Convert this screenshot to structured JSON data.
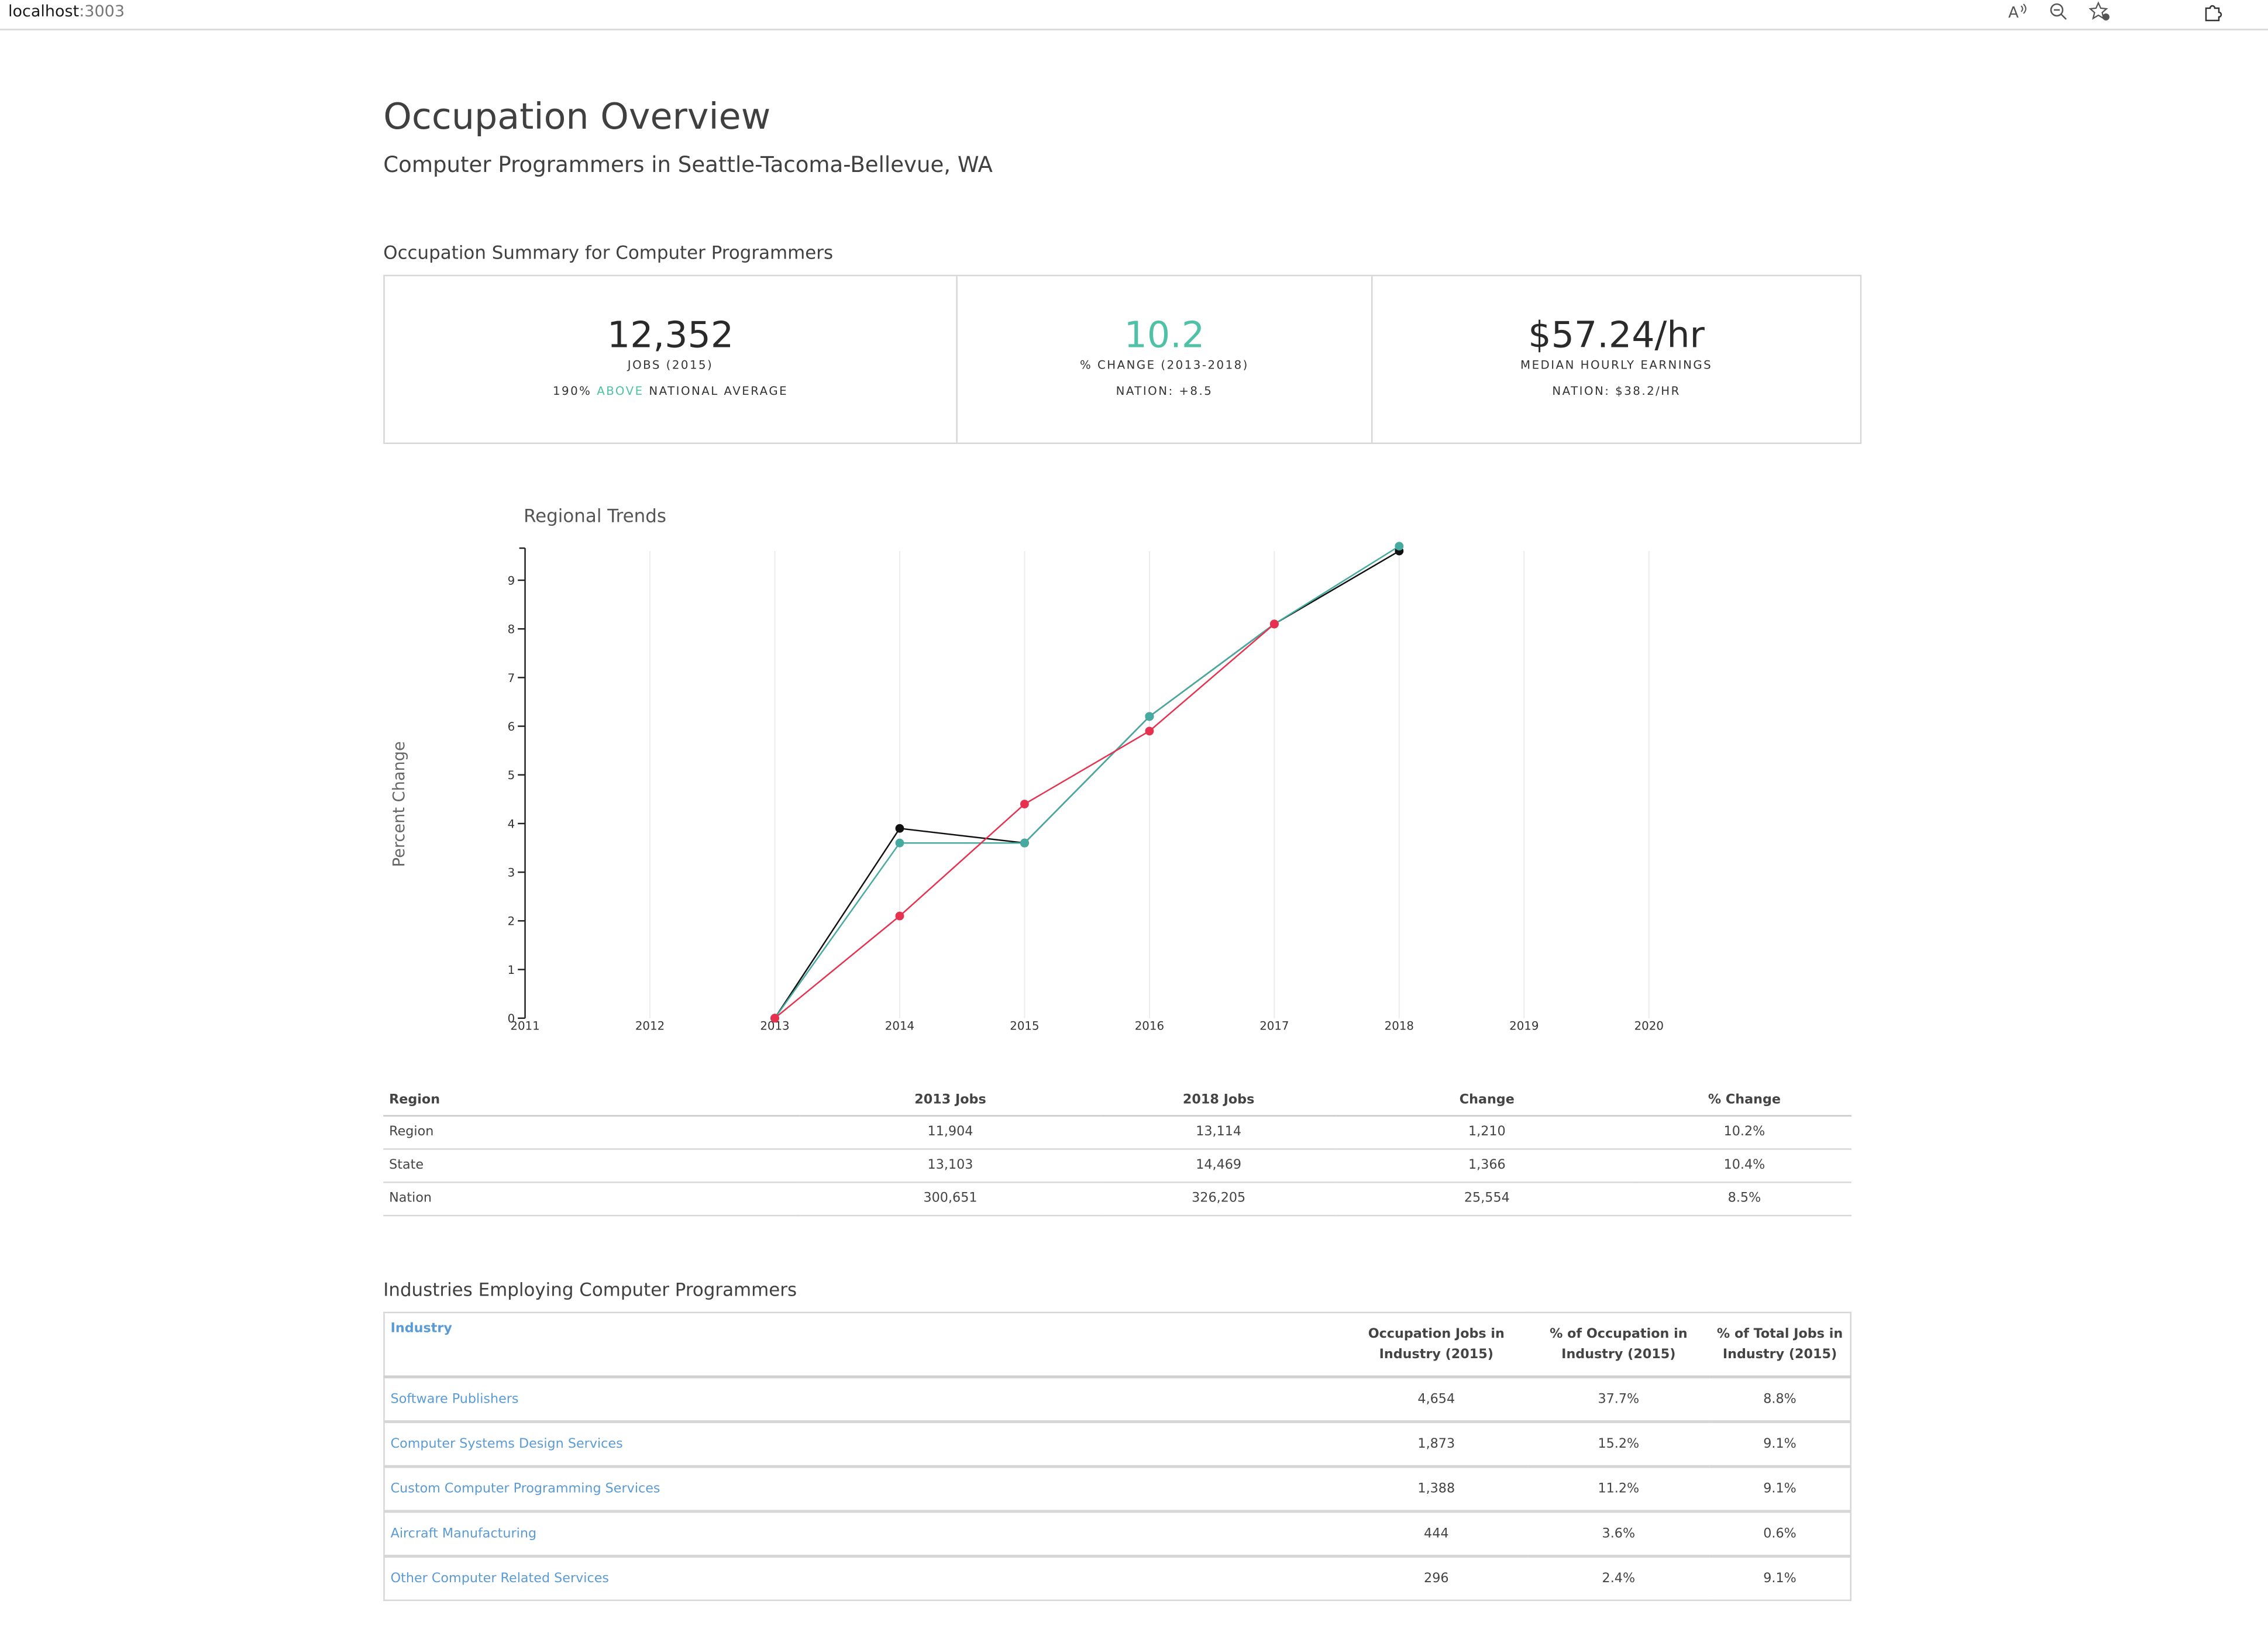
{
  "browser": {
    "address_host": "localhost",
    "address_port": ":3003",
    "icons": [
      "read-aloud-icon",
      "zoom-out-icon",
      "add-favorite-icon",
      "extensions-icon"
    ]
  },
  "page": {
    "title": "Occupation Overview",
    "subtitle": "Computer Programmers in Seattle-Tacoma-Bellevue, WA"
  },
  "summary": {
    "section_title": "Occupation Summary for Computer Programmers",
    "jobs": {
      "value": "12,352",
      "label": "JOBS (2015)",
      "sub_prefix": "190% ",
      "sub_highlight": "ABOVE",
      "sub_suffix": " NATIONAL AVERAGE"
    },
    "change": {
      "value": "10.2",
      "label": "% CHANGE (2013-2018)",
      "sub": "NATION: +8.5"
    },
    "earnings": {
      "value": "$57.24/hr",
      "label": "MEDIAN HOURLY EARNINGS",
      "sub": "NATION: $38.2/HR"
    }
  },
  "colors": {
    "accent": "#4fc1a6",
    "link": "#5b9bd5",
    "nation_line": "#e8304f",
    "region_line": "#111111",
    "state_line": "#47aaa0"
  },
  "chart_data": {
    "type": "line",
    "title": "Regional Trends",
    "ylabel": "Percent Change",
    "xlabel": "",
    "xlim": [
      2011,
      2020
    ],
    "ylim": [
      0,
      9.6
    ],
    "x_ticks": [
      "2011",
      "2012",
      "2013",
      "2014",
      "2015",
      "2016",
      "2017",
      "2018",
      "2019",
      "2020"
    ],
    "y_ticks": [
      "0",
      "1",
      "2",
      "3",
      "4",
      "5",
      "6",
      "7",
      "8",
      "9"
    ],
    "grid": "vertical",
    "series": [
      {
        "color": "#111111",
        "points": [
          [
            2013,
            0
          ],
          [
            2014,
            3.9
          ],
          [
            2015,
            3.6
          ],
          [
            2016,
            6.2
          ],
          [
            2017,
            8.1
          ],
          [
            2018,
            9.6
          ]
        ]
      },
      {
        "color": "#47aaa0",
        "points": [
          [
            2013,
            0
          ],
          [
            2014,
            3.6
          ],
          [
            2015,
            3.6
          ],
          [
            2016,
            6.2
          ],
          [
            2017,
            8.1
          ],
          [
            2018,
            9.7
          ]
        ]
      },
      {
        "color": "#e8304f",
        "points": [
          [
            2013,
            0
          ],
          [
            2014,
            2.1
          ],
          [
            2015,
            4.4
          ],
          [
            2016,
            5.9
          ],
          [
            2017,
            8.1
          ]
        ]
      }
    ]
  },
  "region_table": {
    "headers": [
      "Region",
      "2013 Jobs",
      "2018 Jobs",
      "Change",
      "% Change"
    ],
    "rows": [
      [
        "Region",
        "11,904",
        "13,114",
        "1,210",
        "10.2%"
      ],
      [
        "State",
        "13,103",
        "14,469",
        "1,366",
        "10.4%"
      ],
      [
        "Nation",
        "300,651",
        "326,205",
        "25,554",
        "8.5%"
      ]
    ]
  },
  "industries": {
    "section_title": "Industries Employing Computer Programmers",
    "headers": {
      "industry": "Industry",
      "occ_jobs": [
        "Occupation Jobs in",
        "Industry (2015)"
      ],
      "pct_occ": [
        "% of Occupation in",
        "Industry (2015)"
      ],
      "pct_total": [
        "% of Total Jobs in",
        "Industry (2015)"
      ]
    },
    "rows": [
      [
        "Software Publishers",
        "4,654",
        "37.7%",
        "8.8%"
      ],
      [
        "Computer Systems Design Services",
        "1,873",
        "15.2%",
        "9.1%"
      ],
      [
        "Custom Computer Programming Services",
        "1,388",
        "11.2%",
        "9.1%"
      ],
      [
        "Aircraft Manufacturing",
        "444",
        "3.6%",
        "0.6%"
      ],
      [
        "Other Computer Related Services",
        "296",
        "2.4%",
        "9.1%"
      ]
    ]
  }
}
